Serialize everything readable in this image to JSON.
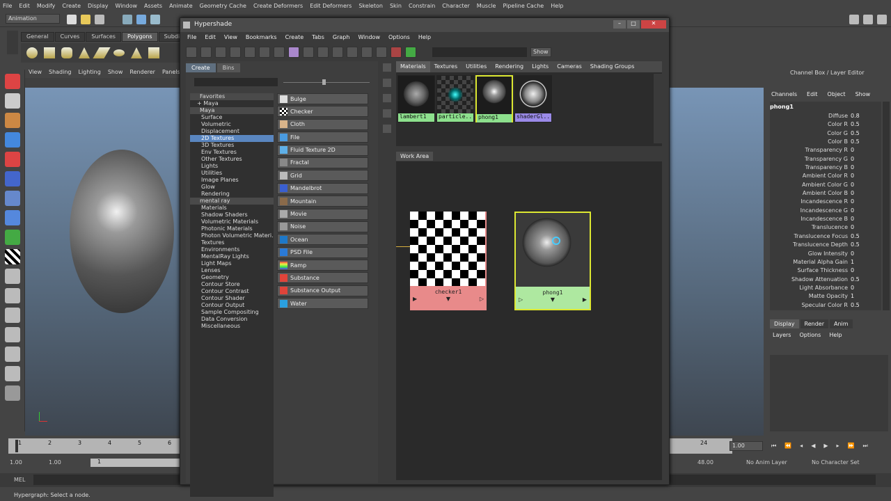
{
  "maya": {
    "menu": [
      "File",
      "Edit",
      "Modify",
      "Create",
      "Display",
      "Window",
      "Assets",
      "Animate",
      "Geometry Cache",
      "Create Deformers",
      "Edit Deformers",
      "Skeleton",
      "Skin",
      "Constrain",
      "Character",
      "Muscle",
      "Pipeline Cache",
      "Help"
    ],
    "mode_dropdown": "Animation",
    "shelf_tabs": [
      "General",
      "Curves",
      "Surfaces",
      "Polygons",
      "Subdiv"
    ],
    "panel_menu": [
      "View",
      "Shading",
      "Lighting",
      "Show",
      "Renderer",
      "Panels"
    ],
    "timeline_ticks": [
      "1",
      "2",
      "3",
      "4",
      "5",
      "6"
    ],
    "timeline_ticks_right": [
      "24"
    ],
    "current_frame": "1.00",
    "range_start": "1.00",
    "range_start2": "1.00",
    "range_marker": "1",
    "range_end": "48.00",
    "no_anim_layer": "No Anim Layer",
    "no_char_set": "No Character Set",
    "mel_label": "MEL",
    "help_line": "Hypergraph: Select a node."
  },
  "channelbox": {
    "header": "Channel Box / Layer Editor",
    "menu": [
      "Channels",
      "Edit",
      "Object",
      "Show"
    ],
    "object": "phong1",
    "attrs": [
      {
        "name": "Diffuse",
        "value": "0.8"
      },
      {
        "name": "Color R",
        "value": "0.5"
      },
      {
        "name": "Color G",
        "value": "0.5"
      },
      {
        "name": "Color B",
        "value": "0.5"
      },
      {
        "name": "Transparency R",
        "value": "0"
      },
      {
        "name": "Transparency G",
        "value": "0"
      },
      {
        "name": "Transparency B",
        "value": "0"
      },
      {
        "name": "Ambient Color R",
        "value": "0"
      },
      {
        "name": "Ambient Color G",
        "value": "0"
      },
      {
        "name": "Ambient Color B",
        "value": "0"
      },
      {
        "name": "Incandescence R",
        "value": "0"
      },
      {
        "name": "Incandescence G",
        "value": "0"
      },
      {
        "name": "Incandescence B",
        "value": "0"
      },
      {
        "name": "Translucence",
        "value": "0"
      },
      {
        "name": "Translucence Focus",
        "value": "0.5"
      },
      {
        "name": "Translucence Depth",
        "value": "0.5"
      },
      {
        "name": "Glow Intensity",
        "value": "0"
      },
      {
        "name": "Material Alpha Gain",
        "value": "1"
      },
      {
        "name": "Surface Thickness",
        "value": "0"
      },
      {
        "name": "Shadow Attenuation",
        "value": "0.5"
      },
      {
        "name": "Light Absorbance",
        "value": "0"
      },
      {
        "name": "Matte Opacity",
        "value": "1"
      },
      {
        "name": "Specular Color R",
        "value": "0.5"
      }
    ],
    "layer_tabs": [
      "Display",
      "Render",
      "Anim"
    ],
    "layer_menu": [
      "Layers",
      "Options",
      "Help"
    ]
  },
  "hypershade": {
    "title": "Hypershade",
    "menu": [
      "File",
      "Edit",
      "View",
      "Bookmarks",
      "Create",
      "Tabs",
      "Graph",
      "Window",
      "Options",
      "Help"
    ],
    "show_button": "Show",
    "create_tabs": [
      "Create",
      "Bins"
    ],
    "tree": [
      {
        "label": "Favorites",
        "indent": 0,
        "hdr": true
      },
      {
        "label": "+ Maya",
        "indent": 1
      },
      {
        "label": "Maya",
        "indent": 0,
        "hdr": true
      },
      {
        "label": "Surface",
        "indent": 2
      },
      {
        "label": "Volumetric",
        "indent": 2
      },
      {
        "label": "Displacement",
        "indent": 2
      },
      {
        "label": "2D Textures",
        "indent": 2,
        "sel": true
      },
      {
        "label": "3D Textures",
        "indent": 2
      },
      {
        "label": "Env Textures",
        "indent": 2
      },
      {
        "label": "Other Textures",
        "indent": 2
      },
      {
        "label": "Lights",
        "indent": 2
      },
      {
        "label": "Utilities",
        "indent": 2
      },
      {
        "label": "Image Planes",
        "indent": 2
      },
      {
        "label": "Glow",
        "indent": 2
      },
      {
        "label": "Rendering",
        "indent": 2
      },
      {
        "label": "mental ray",
        "indent": 0,
        "hdr": true
      },
      {
        "label": "Materials",
        "indent": 2
      },
      {
        "label": "Shadow Shaders",
        "indent": 2
      },
      {
        "label": "Volumetric Materials",
        "indent": 2
      },
      {
        "label": "Photonic Materials",
        "indent": 2
      },
      {
        "label": "Photon Volumetric Materi...",
        "indent": 2
      },
      {
        "label": "Textures",
        "indent": 2
      },
      {
        "label": "Environments",
        "indent": 2
      },
      {
        "label": "MentalRay Lights",
        "indent": 2
      },
      {
        "label": "Light Maps",
        "indent": 2
      },
      {
        "label": "Lenses",
        "indent": 2
      },
      {
        "label": "Geometry",
        "indent": 2
      },
      {
        "label": "Contour Store",
        "indent": 2
      },
      {
        "label": "Contour Contrast",
        "indent": 2
      },
      {
        "label": "Contour Shader",
        "indent": 2
      },
      {
        "label": "Contour Output",
        "indent": 2
      },
      {
        "label": "Sample Compositing",
        "indent": 2
      },
      {
        "label": "Data Conversion",
        "indent": 2
      },
      {
        "label": "Miscellaneous",
        "indent": 2
      }
    ],
    "node_buttons": [
      {
        "label": "Bulge",
        "color": "#ddd"
      },
      {
        "label": "Checker",
        "color": "#111"
      },
      {
        "label": "Cloth",
        "color": "#d9b48a"
      },
      {
        "label": "File",
        "color": "#4a9be0"
      },
      {
        "label": "Fluid Texture 2D",
        "color": "#5fb0e8"
      },
      {
        "label": "Fractal",
        "color": "#888"
      },
      {
        "label": "Grid",
        "color": "#bbb"
      },
      {
        "label": "Mandelbrot",
        "color": "#3a5fd0"
      },
      {
        "label": "Mountain",
        "color": "#8a6a4a"
      },
      {
        "label": "Movie",
        "color": "#aaa"
      },
      {
        "label": "Noise",
        "color": "#999"
      },
      {
        "label": "Ocean",
        "color": "#1e78c8"
      },
      {
        "label": "PSD File",
        "color": "#2a7ad8"
      },
      {
        "label": "Ramp",
        "color": "#e84"
      },
      {
        "label": "Substance",
        "color": "#e0443a"
      },
      {
        "label": "Substance Output",
        "color": "#e0443a"
      },
      {
        "label": "Water",
        "color": "#2aa0e0"
      }
    ],
    "mat_tabs": [
      "Materials",
      "Textures",
      "Utilities",
      "Rendering",
      "Lights",
      "Cameras",
      "Shading Groups"
    ],
    "swatches": [
      {
        "label": "lambert1",
        "lblcolor": "#8de08d"
      },
      {
        "label": "particle...",
        "lblcolor": "#8de08d"
      },
      {
        "label": "phong1",
        "lblcolor": "#8de08d"
      },
      {
        "label": "shaderGl...",
        "lblcolor": "#9a8ae8"
      }
    ],
    "work_area_tab": "Work Area",
    "graph_nodes": [
      {
        "label": "checker1",
        "color": "#e88a8a"
      },
      {
        "label": "phong1",
        "color": "#aee8a0"
      }
    ]
  }
}
